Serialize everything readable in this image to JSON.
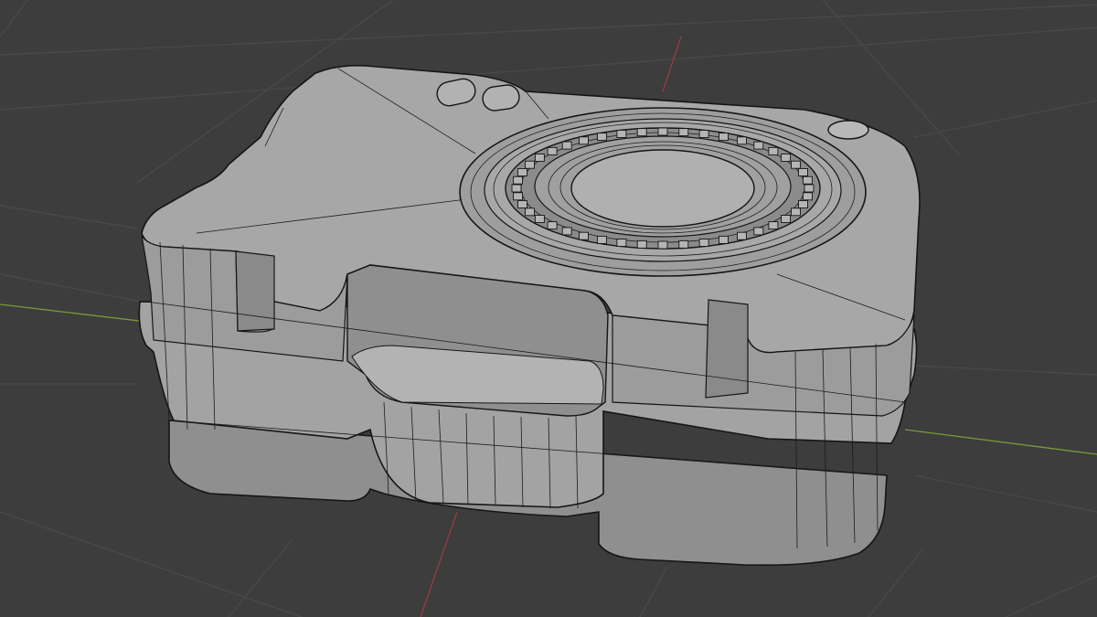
{
  "viewport": {
    "background_color": "#3d3d3d",
    "grid_color": "#4a4a4a",
    "x_axis_color": "#7a9a3a",
    "y_axis_color": "#9a3a44",
    "model_face_color": "#a9a9a9",
    "model_shadow_color": "#8e8e8e",
    "wire_color": "#1c1c1c"
  }
}
